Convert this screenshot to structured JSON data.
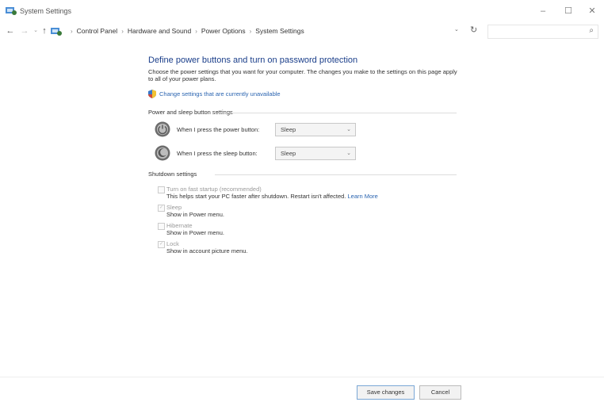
{
  "window": {
    "title": "System Settings",
    "minimize_glyph": "–",
    "maximize_glyph": "☐",
    "close_glyph": "✕"
  },
  "nav": {
    "back_glyph": "←",
    "forward_glyph": "→",
    "recent_glyph": "⌄",
    "up_glyph": "↑",
    "breadcrumbs": [
      "Control Panel",
      "Hardware and Sound",
      "Power Options",
      "System Settings"
    ],
    "separator": "›",
    "dropdown_glyph": "⌄",
    "refresh_glyph": "↻",
    "search_value": "",
    "search_glyph": "⌕"
  },
  "main": {
    "title": "Define power buttons and turn on password protection",
    "intro": "Choose the power settings that you want for your computer. The changes you make to the settings on this page apply to all of your power plans.",
    "change_link": "Change settings that are currently unavailable",
    "power_section": {
      "title": "Power and sleep button settings",
      "rows": [
        {
          "label": "When I press the power button:",
          "value": "Sleep",
          "icon": "power-button-icon"
        },
        {
          "label": "When I press the sleep button:",
          "value": "Sleep",
          "icon": "sleep-button-icon"
        }
      ]
    },
    "shutdown_section": {
      "title": "Shutdown settings",
      "options": [
        {
          "label": "Turn on fast startup (recommended)",
          "desc": "This helps start your PC faster after shutdown. Restart isn't affected.",
          "link": "Learn More",
          "checked": false
        },
        {
          "label": "Sleep",
          "desc": "Show in Power menu.",
          "checked": true
        },
        {
          "label": "Hibernate",
          "desc": "Show in Power menu.",
          "checked": false
        },
        {
          "label": "Lock",
          "desc": "Show in account picture menu.",
          "checked": true
        }
      ]
    }
  },
  "footer": {
    "save_label": "Save changes",
    "cancel_label": "Cancel"
  },
  "colors": {
    "title_blue": "#1a3e8a",
    "link_blue": "#2a64b0"
  }
}
